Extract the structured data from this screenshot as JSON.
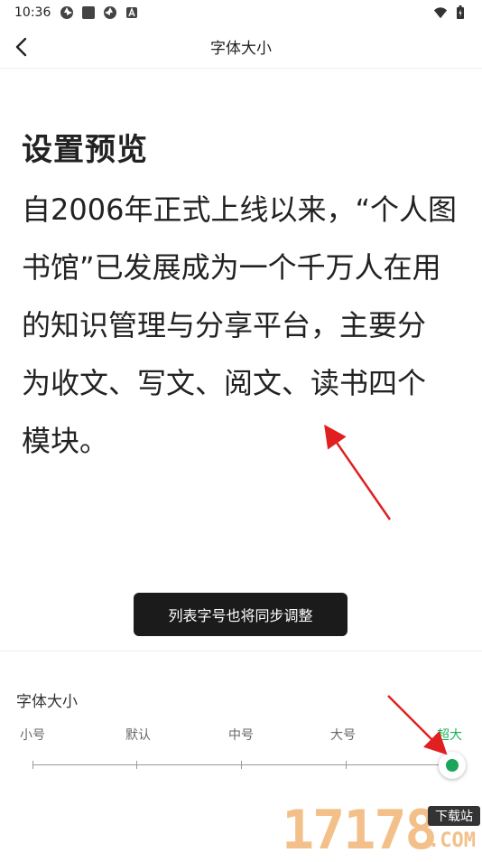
{
  "status": {
    "time": "10:36"
  },
  "nav": {
    "title": "字体大小"
  },
  "preview": {
    "title": "设置预览",
    "body_lines": [
      "自2006年正式上线以来，“个人图",
      "书馆”已发展成为一个千万人在用",
      "的知识管理与分享平台，主要分",
      "为收文、写文、阅文、读书四个",
      "模块。"
    ]
  },
  "toast": {
    "text": "列表字号也将同步调整"
  },
  "font_size": {
    "label": "字体大小",
    "options": [
      "小号",
      "默认",
      "中号",
      "大号",
      "超大"
    ],
    "selected_index": 4
  },
  "watermark": {
    "digits": "17178",
    "tag": "下载站",
    "domain": ".COM"
  },
  "colors": {
    "accent": "#19a55a",
    "accent_text": "#19b25a",
    "toast_bg": "#1b1b1b",
    "annotation_arrow": "#e02020"
  }
}
